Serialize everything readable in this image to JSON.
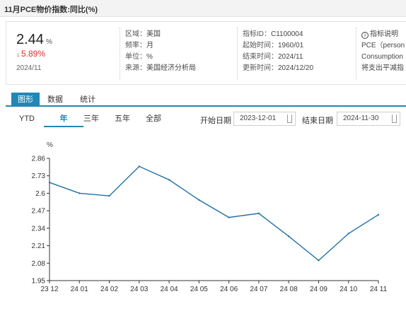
{
  "header": {
    "title": "11月PCE物价指数:同比(%)"
  },
  "summary": {
    "value": "2.44",
    "unit": "%",
    "change": "5.89%",
    "date": "2024/11"
  },
  "details": {
    "col1": [
      {
        "label": "区域：",
        "value": "美国"
      },
      {
        "label": "频率：",
        "value": "月"
      },
      {
        "label": "单位：",
        "value": "%"
      },
      {
        "label": "来源：",
        "value": "美国经济分析局"
      }
    ],
    "col2": [
      {
        "label": "指标ID：",
        "value": "C1100004"
      },
      {
        "label": "起始时间：",
        "value": "1960/01"
      },
      {
        "label": "结束时间：",
        "value": "2024/11"
      },
      {
        "label": "更新时间：",
        "value": "2024/12/20"
      }
    ],
    "col3": {
      "link": "指标说明",
      "lines": [
        "PCE（person",
        "Consumption",
        "将支出平减指"
      ]
    }
  },
  "tabs": [
    "图形",
    "数据",
    "统计"
  ],
  "ranges": [
    "YTD",
    "年",
    "三年",
    "五年",
    "全部"
  ],
  "date_range": {
    "start_label": "开始日期",
    "start_value": "2023-12-01",
    "end_label": "结束日期",
    "end_value": "2024-11-30"
  },
  "colors": {
    "line": "#1f6fa6",
    "accent": "#1f88b6",
    "down": "#d9302c"
  },
  "icons": [
    "info-circle-icon",
    "calendar-icon",
    "down-arrow-icon"
  ],
  "chart_data": {
    "type": "line",
    "unit_label": "%",
    "categories": [
      "23 12",
      "24 01",
      "24 02",
      "24 03",
      "24 04",
      "24 05",
      "24 06",
      "24 07",
      "24 08",
      "24 09",
      "24 10",
      "24 11"
    ],
    "values": [
      2.68,
      2.6,
      2.58,
      2.8,
      2.7,
      2.55,
      2.42,
      2.45,
      2.28,
      2.1,
      2.3,
      2.44
    ],
    "yticks": [
      "2.86",
      "2.73",
      "2.6",
      "2.47",
      "2.34",
      "2.21",
      "2.08",
      "1.95"
    ],
    "ylim": [
      1.95,
      2.86
    ],
    "xlabel": "",
    "ylabel": "",
    "grid": false
  }
}
